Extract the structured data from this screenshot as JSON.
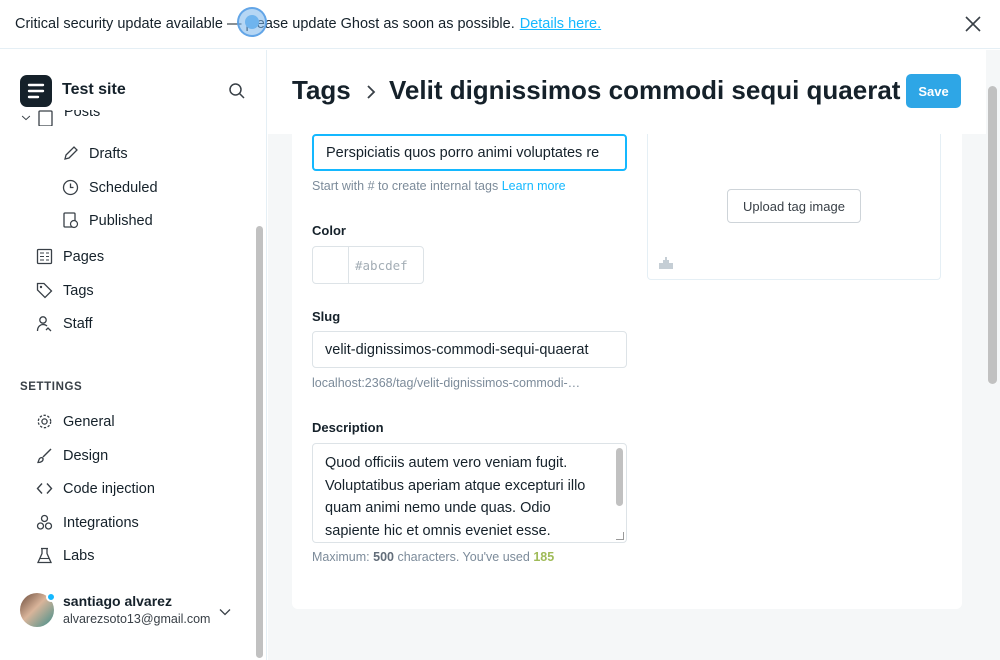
{
  "alert": {
    "message": "Critical security update available — please update Ghost as soon as possible.",
    "link": "Details here."
  },
  "sidebar": {
    "site_name": "Test site",
    "posts_label": "Posts",
    "items": [
      {
        "label": "Drafts",
        "icon": "pencil-icon"
      },
      {
        "label": "Scheduled",
        "icon": "clock-icon"
      },
      {
        "label": "Published",
        "icon": "published-icon"
      },
      {
        "label": "Pages",
        "icon": "pages-icon"
      },
      {
        "label": "Tags",
        "icon": "tag-icon"
      },
      {
        "label": "Staff",
        "icon": "staff-icon"
      }
    ],
    "settings_heading": "SETTINGS",
    "settings": [
      {
        "label": "General",
        "icon": "gear-icon"
      },
      {
        "label": "Design",
        "icon": "brush-icon"
      },
      {
        "label": "Code injection",
        "icon": "code-icon"
      },
      {
        "label": "Integrations",
        "icon": "integrations-icon"
      },
      {
        "label": "Labs",
        "icon": "flask-icon"
      }
    ],
    "user": {
      "name": "santiago alvarez",
      "email": "alvarezsoto13@gmail.com"
    }
  },
  "header": {
    "breadcrumb": "Tags",
    "title": "Velit dignissimos commodi sequi quaerat",
    "save_label": "Save"
  },
  "form": {
    "name_value": "Perspiciatis quos porro animi voluptates re",
    "name_hint": "Start with # to create internal tags",
    "name_hint_link": "Learn more",
    "color_label": "Color",
    "color_placeholder": "#abcdef",
    "slug_label": "Slug",
    "slug_value": "velit-dignissimos-commodi-sequi-quaerat",
    "slug_url": "localhost:2368/tag/velit-dignissimos-commodi-…",
    "description_label": "Description",
    "description_value": "Quod officiis autem vero veniam fugit. Voluptatibus aperiam atque excepturi illo quam animi nemo unde quas. Odio sapiente hic et omnis eveniet esse.",
    "desc_hint_prefix": "Maximum:",
    "desc_max": "500",
    "desc_hint_mid": "characters. You've used",
    "desc_used": "185",
    "upload_label": "Upload tag image"
  },
  "colors": {
    "accent": "#14b8ff",
    "count_green": "#9fbb58"
  }
}
